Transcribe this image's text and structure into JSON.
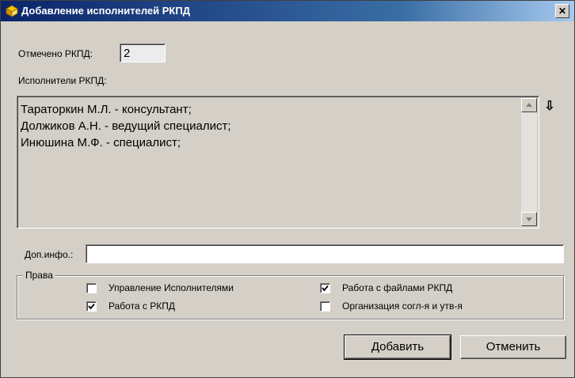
{
  "window": {
    "title": "Добавление исполнителей РКПД",
    "close_glyph": "✕"
  },
  "marked": {
    "label": "Отмечено РКПД:",
    "value": "2"
  },
  "executors": {
    "label": "Исполнители РКПД:",
    "items": [
      "Тараторкин М.Л. - консультант;",
      "Должиков А.Н. - ведущий специалист;",
      "Инюшина М.Ф. - специалист;"
    ],
    "sort_glyph": "⇩"
  },
  "extra_info": {
    "label": "Доп.инфо.:",
    "value": ""
  },
  "rights": {
    "legend": "Права",
    "options": [
      {
        "label": "Управление Исполнителями",
        "checked": false
      },
      {
        "label": "Работа с РКПД",
        "checked": true
      },
      {
        "label": "Работа с файлами РКПД",
        "checked": true
      },
      {
        "label": "Организация согл-я и утв-я",
        "checked": false
      }
    ]
  },
  "buttons": {
    "add": "Добавить",
    "cancel": "Отменить"
  }
}
